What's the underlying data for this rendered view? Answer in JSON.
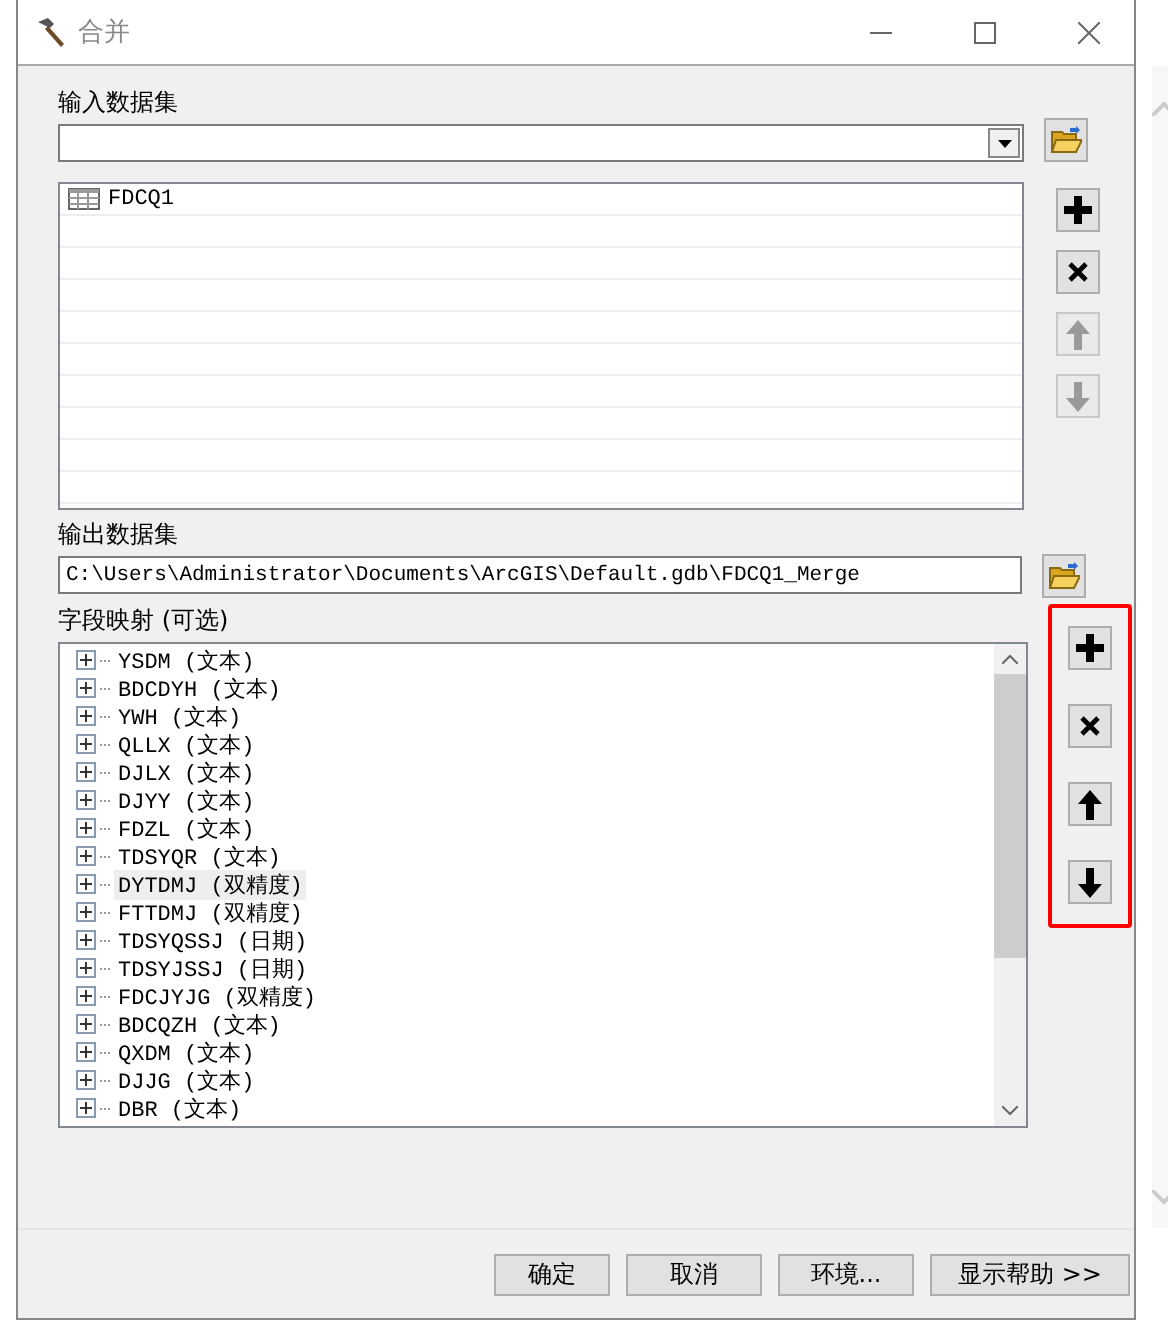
{
  "window": {
    "title": "合并"
  },
  "input": {
    "label": "输入数据集",
    "datasets": [
      {
        "name": "FDCQ1"
      }
    ],
    "buttons": [
      {
        "kind": "add",
        "disabled": false
      },
      {
        "kind": "remove",
        "disabled": false
      },
      {
        "kind": "up",
        "disabled": true
      },
      {
        "kind": "down",
        "disabled": true
      }
    ]
  },
  "output": {
    "label": "输出数据集",
    "value": "C:\\Users\\Administrator\\Documents\\ArcGIS\\Default.gdb\\FDCQ1_Merge"
  },
  "field_map": {
    "label": "字段映射 (可选)",
    "fields": [
      {
        "name": "YSDM (文本)",
        "selected": false
      },
      {
        "name": "BDCDYH (文本)",
        "selected": false
      },
      {
        "name": "YWH (文本)",
        "selected": false
      },
      {
        "name": "QLLX (文本)",
        "selected": false
      },
      {
        "name": "DJLX (文本)",
        "selected": false
      },
      {
        "name": "DJYY (文本)",
        "selected": false
      },
      {
        "name": "FDZL (文本)",
        "selected": false
      },
      {
        "name": "TDSYQR (文本)",
        "selected": false
      },
      {
        "name": "DYTDMJ (双精度)",
        "selected": true
      },
      {
        "name": "FTTDMJ (双精度)",
        "selected": false
      },
      {
        "name": "TDSYQSSJ (日期)",
        "selected": false
      },
      {
        "name": "TDSYJSSJ (日期)",
        "selected": false
      },
      {
        "name": "FDCJYJG (双精度)",
        "selected": false
      },
      {
        "name": "BDCQZH (文本)",
        "selected": false
      },
      {
        "name": "QXDM (文本)",
        "selected": false
      },
      {
        "name": "DJJG (文本)",
        "selected": false
      },
      {
        "name": "DBR (文本)",
        "selected": false
      }
    ],
    "buttons": [
      {
        "kind": "add",
        "disabled": false
      },
      {
        "kind": "remove",
        "disabled": false
      },
      {
        "kind": "up",
        "disabled": false
      },
      {
        "kind": "down",
        "disabled": false
      }
    ]
  },
  "footer_buttons": [
    "确定",
    "取消",
    "环境...",
    "显示帮助 >>"
  ]
}
